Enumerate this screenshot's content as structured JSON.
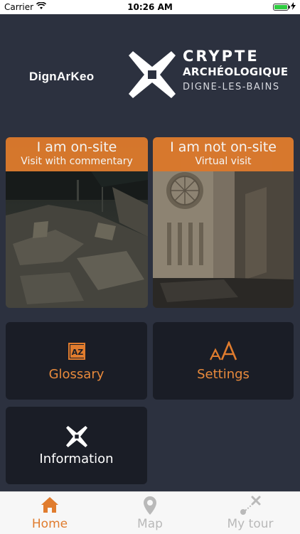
{
  "status": {
    "carrier": "Carrier",
    "time": "10:26 AM"
  },
  "header": {
    "brand": "DignArKeo",
    "logo_line1": "CRYPTE",
    "logo_line2": "ARCHÉOLOGIQUE",
    "logo_line3": "DIGNE-LES-BAINS"
  },
  "cards": {
    "onsite": {
      "title": "I am on-site",
      "subtitle": "Visit with commentary"
    },
    "offsite": {
      "title": "I am not on-site",
      "subtitle": "Virtual visit"
    }
  },
  "tiles": {
    "glossary": "Glossary",
    "settings": "Settings",
    "information": "Information"
  },
  "tabs": {
    "home": "Home",
    "map": "Map",
    "mytour": "My tour"
  },
  "colors": {
    "accent": "#e07c2e",
    "background": "#2c313f",
    "tile": "#1a1d26",
    "tab_inactive": "#b9b9b9"
  },
  "icons": {
    "glossary": "az-book-icon",
    "settings": "text-size-icon",
    "information": "cross-logo-icon",
    "home": "house-icon",
    "map": "map-pin-icon",
    "mytour": "route-icon"
  }
}
